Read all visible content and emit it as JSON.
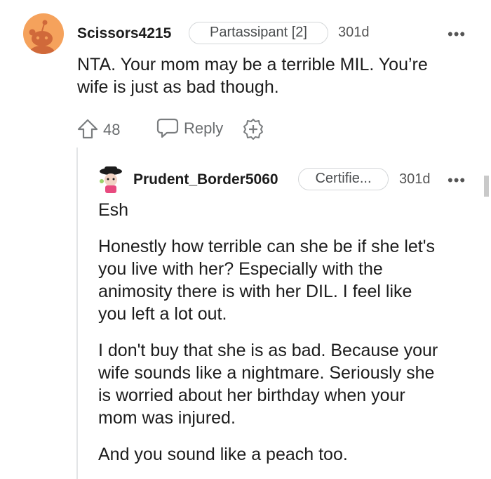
{
  "comment": {
    "username": "Scissors4215",
    "flair": "Partassipant [2]",
    "age": "301d",
    "more": "•••",
    "body": [
      "NTA. Your mom may be a terrible MIL. You’re",
      "wife is just as bad though."
    ],
    "upvotes": "48",
    "reply_label": "Reply"
  },
  "reply": {
    "username": "Prudent_Border5060",
    "flair": "Certifie...",
    "age": "301d",
    "more": "•••",
    "paragraphs": [
      [
        "Esh"
      ],
      [
        "Honestly how terrible can she be if she let's",
        "you live with her? Especially with the",
        "animosity there is with her DIL. I feel like",
        "you left a lot out."
      ],
      [
        "I don't buy that she is as bad. Because your",
        "wife sounds like a nightmare. Seriously she",
        "is worried about her birthday when your",
        "mom was injured."
      ],
      [
        "And you sound like a peach too."
      ]
    ]
  },
  "colors": {
    "avatar_bg": "#f5a25c",
    "text": "#1c1c1c",
    "muted": "#6a6d6f",
    "border": "#d4d7d9"
  }
}
